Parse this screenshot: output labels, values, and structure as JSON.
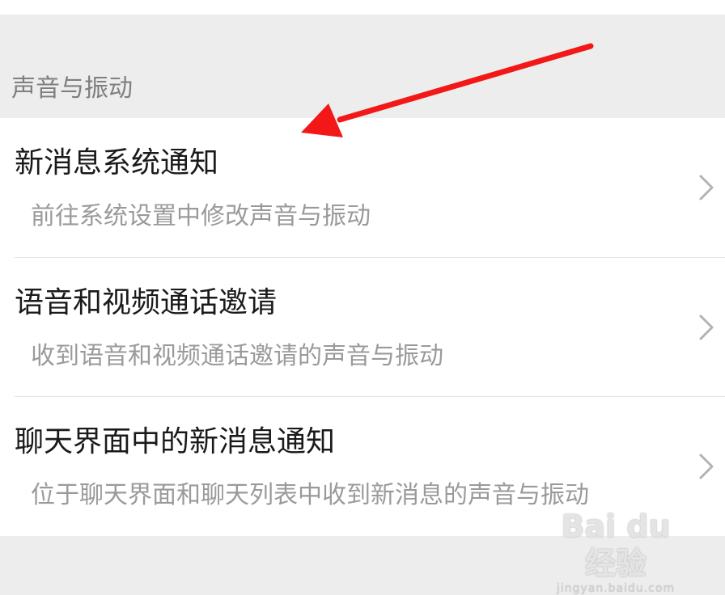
{
  "section": {
    "header": "声音与振动"
  },
  "items": [
    {
      "title": "新消息系统通知",
      "subtitle": "前往系统设置中修改声音与振动",
      "chevron_icon": "chevron-right-icon"
    },
    {
      "title": "语音和视频通话邀请",
      "subtitle": "收到语音和视频通话邀请的声音与振动",
      "chevron_icon": "chevron-right-icon"
    },
    {
      "title": "聊天界面中的新消息通知",
      "subtitle": "位于聊天界面和聊天列表中收到新消息的声音与振动",
      "chevron_icon": "chevron-right-icon"
    }
  ],
  "annotation": {
    "arrow_color": "#f21818"
  },
  "watermark": {
    "main": "Bai du 经验",
    "sub": "jingyan.baidu.com"
  },
  "colors": {
    "background": "#ededed",
    "card": "#ffffff",
    "title": "#1a1a1a",
    "subtitle": "#9a9a9a",
    "header": "#7f7f7f"
  }
}
